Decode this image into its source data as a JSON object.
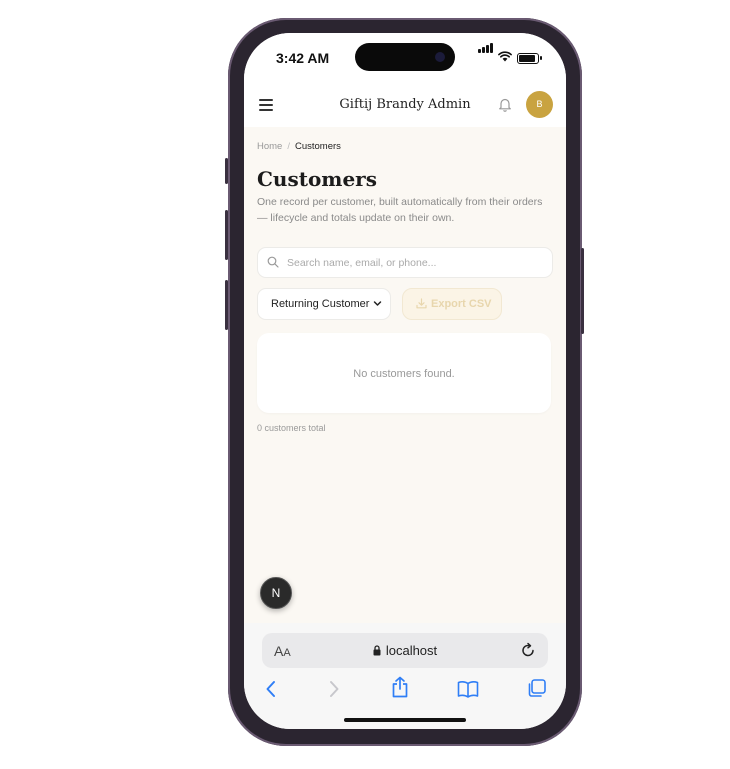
{
  "status_bar": {
    "time": "3:42 AM"
  },
  "header": {
    "title": "Giftij Brandy Admin",
    "avatar_initial": "B"
  },
  "breadcrumb": {
    "home": "Home",
    "separator": "/",
    "current": "Customers"
  },
  "page": {
    "title": "Customers",
    "subtitle": "One record per customer, built automatically from their orders — lifecycle and totals update on their own."
  },
  "search": {
    "placeholder": "Search name, email, or phone...",
    "value": ""
  },
  "filter": {
    "selected": "Returning Customer"
  },
  "export": {
    "label": "Export CSV"
  },
  "customers": {
    "empty_message": "No customers found.",
    "total_text": "0 customers total"
  },
  "dev_badge": {
    "letter": "N"
  },
  "browser": {
    "aa_large": "A",
    "aa_small": "A",
    "url": "localhost"
  },
  "colors": {
    "accent": "#c9a340",
    "background": "#fbf8f3",
    "safari_blue": "#2f7ef6"
  }
}
